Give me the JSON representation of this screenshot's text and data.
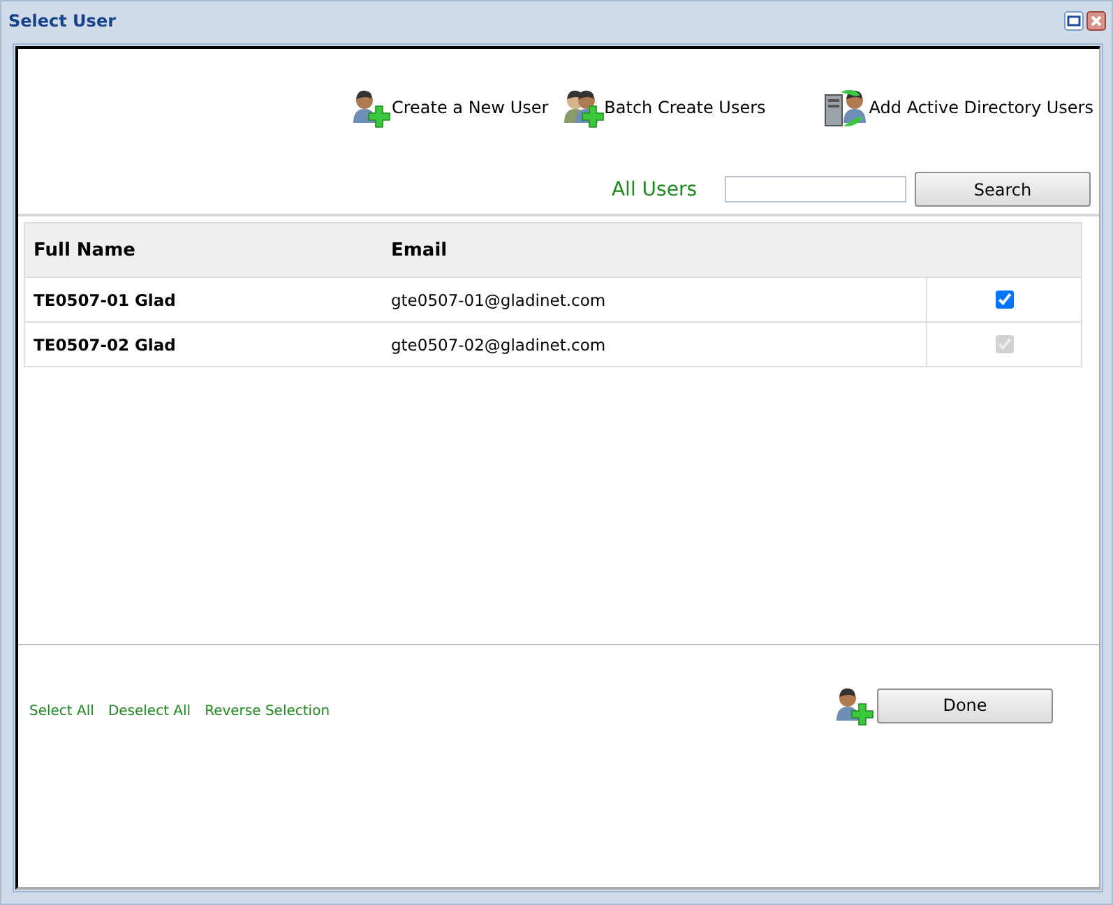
{
  "window": {
    "title": "Select User"
  },
  "actions": [
    {
      "kind": "new",
      "label": "Create a New User"
    },
    {
      "kind": "batch",
      "label": "Batch Create Users"
    },
    {
      "kind": "directory",
      "label": "Add Active Directory Users"
    }
  ],
  "filter": {
    "label": "All Users",
    "search_button": "Search"
  },
  "table": {
    "columns": [
      "Full Name",
      "Email"
    ],
    "rows": [
      {
        "name": "TE0507-01 Glad",
        "email": "gte0507-01@gladinet.com",
        "checked": true,
        "disabled": false
      },
      {
        "name": "TE0507-02 Glad",
        "email": "gte0507-02@gladinet.com",
        "checked": true,
        "disabled": true
      }
    ]
  },
  "footer": {
    "links": [
      "Select All",
      "Deselect All",
      "Reverse Selection"
    ],
    "done_button": "Done"
  }
}
